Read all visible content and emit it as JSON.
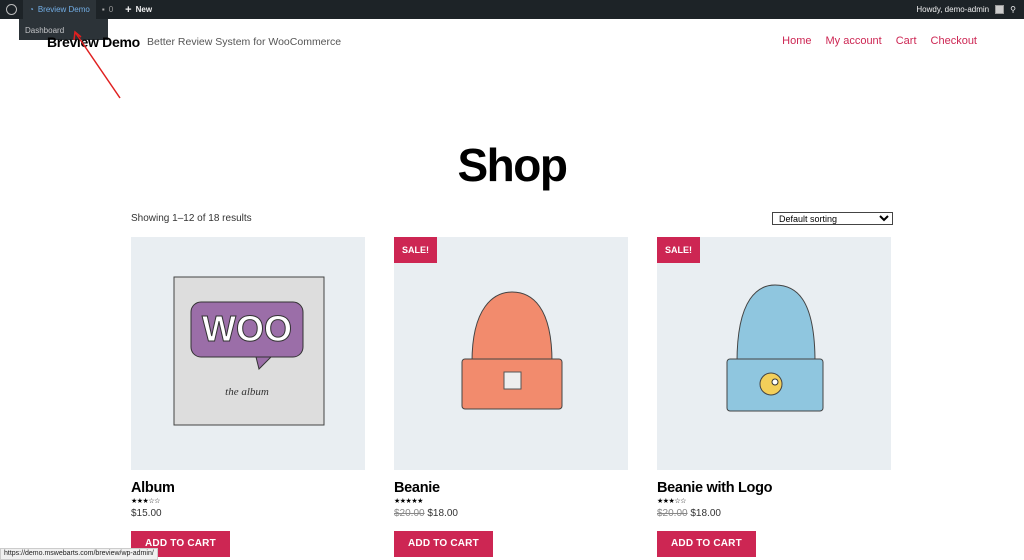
{
  "admin_bar": {
    "site": "Breview Demo",
    "comments": "0",
    "new": "New",
    "howdy": "Howdy, demo-admin",
    "dropdown_item": "Dashboard"
  },
  "header": {
    "site_title": "Breview Demo",
    "tagline": "Better Review System for WooCommerce",
    "nav": [
      "Home",
      "My account",
      "Cart",
      "Checkout"
    ]
  },
  "main": {
    "title": "Shop",
    "result_count": "Showing 1–12 of 18 results",
    "sorting": "Default sorting",
    "products": [
      {
        "name": "Album",
        "rating": 3,
        "stars": "★★★☆☆",
        "price": "$15.00",
        "regular_price": "",
        "sale": false,
        "button": "ADD TO CART"
      },
      {
        "name": "Beanie",
        "rating": 5,
        "stars": "★★★★★",
        "price": "$18.00",
        "regular_price": "$20.00",
        "sale": true,
        "sale_label": "SALE!",
        "button": "ADD TO CART"
      },
      {
        "name": "Beanie with Logo",
        "rating": 3,
        "stars": "★★★☆☆",
        "price": "$18.00",
        "regular_price": "$20.00",
        "sale": true,
        "sale_label": "SALE!",
        "button": "ADD TO CART"
      }
    ]
  },
  "status_bar": "https://demo.mswebarts.com/breview/wp-admin/",
  "colors": {
    "accent": "#cd2653",
    "admin_bar": "#1d2327",
    "product_bg": "#e9eef2"
  }
}
